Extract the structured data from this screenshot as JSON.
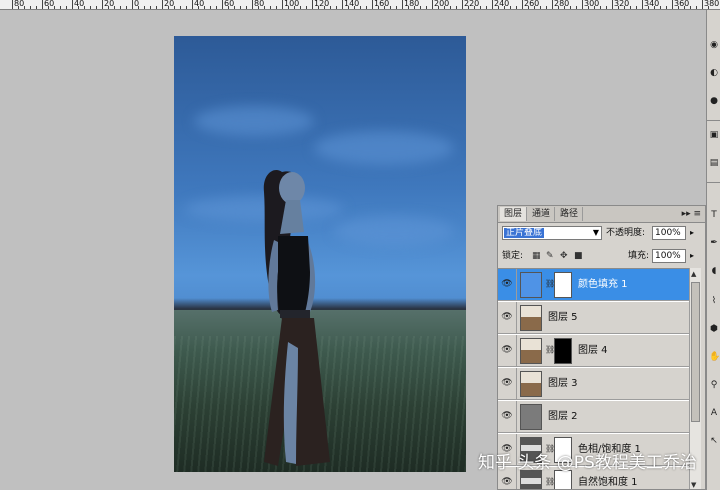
{
  "ruler": {
    "labels": [
      "80",
      "60",
      "40",
      "20",
      "0",
      "20",
      "40",
      "60",
      "80",
      "100",
      "120",
      "140",
      "160",
      "180",
      "200",
      "220",
      "240",
      "260",
      "280",
      "300",
      "320",
      "340",
      "360",
      "380"
    ]
  },
  "panel": {
    "tabs": [
      "图层",
      "通道",
      "路径"
    ],
    "tab_menu": "▸▸ ≡",
    "blend_mode": "正片叠底",
    "opacity_label": "不透明度:",
    "opacity_value": "100%",
    "lock_label": "锁定:",
    "fill_label": "填充:",
    "fill_value": "100%",
    "layers": [
      {
        "name": "颜色填充 1",
        "selected": true,
        "thumb": "fill-blue",
        "has_mask": true
      },
      {
        "name": "图层 5",
        "selected": false,
        "thumb": "photo",
        "has_mask": false
      },
      {
        "name": "图层 4",
        "selected": false,
        "thumb": "photo",
        "has_mask": true
      },
      {
        "name": "图层 3",
        "selected": false,
        "thumb": "photo",
        "has_mask": false
      },
      {
        "name": "图层 2",
        "selected": false,
        "thumb": "gray",
        "has_mask": false
      },
      {
        "name": "色相/饱和度 1",
        "selected": false,
        "thumb": "adjust",
        "has_mask": true
      },
      {
        "name": "自然饱和度 1",
        "selected": false,
        "thumb": "adjust",
        "has_mask": true
      }
    ]
  },
  "watermark": "知乎 头条 @PS教程美工乔治",
  "colors": {
    "selected_layer": "#3a8ee6",
    "fill_blue": "#4f93e6",
    "panel_bg": "#d6d3ce"
  }
}
